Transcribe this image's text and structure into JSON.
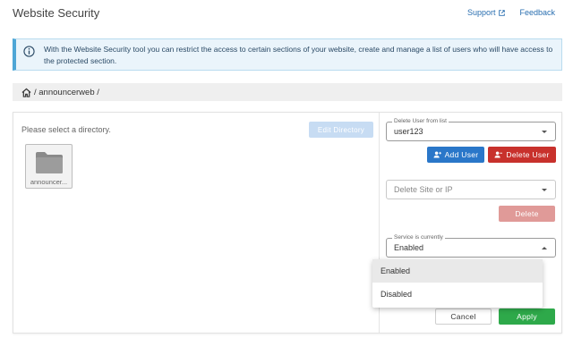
{
  "header": {
    "title": "Website Security",
    "links": [
      {
        "label": "Support",
        "icon": "external-link-icon"
      },
      {
        "label": "Feedback"
      }
    ]
  },
  "info_banner": {
    "icon": "info-icon",
    "text": "With the Website Security tool you can restrict the access to certain sections of your website, create and manage a list of users who will have access to the protected section."
  },
  "breadcrumb": {
    "icon": "home-icon",
    "path": "/ announcerweb /"
  },
  "left_pane": {
    "prompt": "Please select a directory.",
    "edit_directory_label": "Edit Directory",
    "folders": [
      {
        "label": "announcer...",
        "icon": "folder-icon"
      }
    ]
  },
  "right_pane": {
    "user_select": {
      "legend": "Delete User from list",
      "value": "user123"
    },
    "add_user_label": "Add User",
    "delete_user_label": "Delete User",
    "site_select": {
      "placeholder": "Delete Site or IP"
    },
    "delete_label": "Delete",
    "service_select": {
      "legend": "Service is currently",
      "value": "Enabled"
    },
    "service_options": [
      "Enabled",
      "Disabled"
    ],
    "cancel_label": "Cancel",
    "apply_label": "Apply"
  },
  "colors": {
    "accent_blue": "#2a77c9",
    "danger_red": "#c8312c",
    "success_green": "#2ea94a",
    "info_border": "#4ea6d6"
  }
}
